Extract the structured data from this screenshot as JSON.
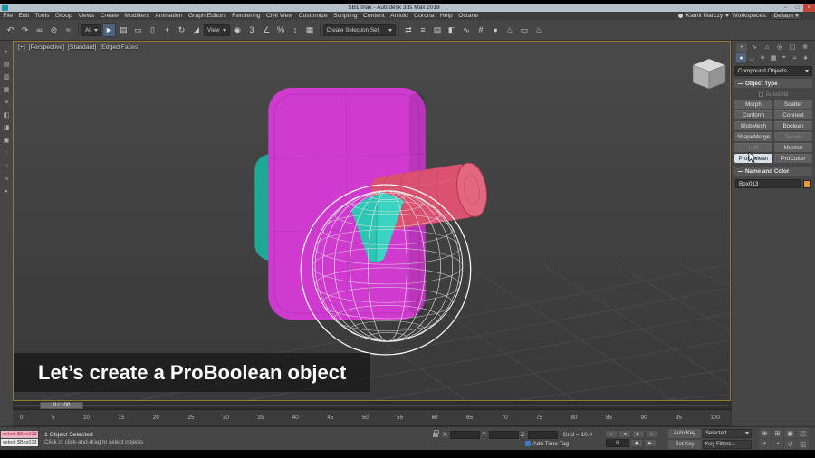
{
  "titlebar": {
    "title": "SB1.max - Autodesk 3ds Max 2018",
    "window_buttons": [
      {
        "name": "minimize-button",
        "glyph": "−"
      },
      {
        "name": "maximize-button",
        "glyph": "□"
      },
      {
        "name": "close-button",
        "glyph": "×"
      }
    ]
  },
  "menubar": {
    "items": [
      "File",
      "Edit",
      "Tools",
      "Group",
      "Views",
      "Create",
      "Modifiers",
      "Animation",
      "Graph Editors",
      "Rendering",
      "Civil View",
      "Customize",
      "Scripting",
      "Content",
      "Arnold",
      "Corona",
      "Help",
      "Octane"
    ],
    "user_name": "Kamil Marczy",
    "workspaces_label": "Workspaces:",
    "workspaces_value": "Default"
  },
  "toolbar": {
    "icons_a": [
      {
        "name": "undo-icon",
        "glyph": "↶"
      },
      {
        "name": "redo-icon",
        "glyph": "↷"
      },
      {
        "name": "select-link-icon",
        "glyph": "∞"
      },
      {
        "name": "unlink-icon",
        "glyph": "⊘"
      },
      {
        "name": "bind-spacewarp-icon",
        "glyph": "≈"
      }
    ],
    "selection_filter": "All",
    "icons_b": [
      {
        "name": "select-object-icon",
        "glyph": "►",
        "state": "active"
      },
      {
        "name": "select-by-name-icon",
        "glyph": "▤"
      },
      {
        "name": "rect-region-icon",
        "glyph": "▭"
      },
      {
        "name": "window-crossing-icon",
        "glyph": "▯"
      },
      {
        "name": "select-move-icon",
        "glyph": "+"
      },
      {
        "name": "select-rotate-icon",
        "glyph": "↻"
      },
      {
        "name": "select-scale-icon",
        "glyph": "◢"
      }
    ],
    "ref_coord": "View",
    "icons_c": [
      {
        "name": "use-center-icon",
        "glyph": "◉"
      },
      {
        "name": "snaps-toggle-icon",
        "glyph": "3"
      },
      {
        "name": "angle-snap-icon",
        "glyph": "∠"
      },
      {
        "name": "percent-snap-icon",
        "glyph": "%"
      },
      {
        "name": "spinner-snap-icon",
        "glyph": "↕"
      },
      {
        "name": "edit-named-selections-icon",
        "glyph": "▦"
      }
    ],
    "named_selection_placeholder": "Create Selection Set",
    "icons_d": [
      {
        "name": "mirror-icon",
        "glyph": "⇄"
      },
      {
        "name": "align-icon",
        "glyph": "≡"
      },
      {
        "name": "layer-manager-icon",
        "glyph": "▤"
      },
      {
        "name": "ribbon-icon",
        "glyph": "◧"
      },
      {
        "name": "curve-editor-icon",
        "glyph": "∿"
      },
      {
        "name": "schematic-view-icon",
        "glyph": "#"
      },
      {
        "name": "material-editor-icon",
        "glyph": "●"
      },
      {
        "name": "render-setup-icon",
        "glyph": "♨"
      },
      {
        "name": "rendered-frame-icon",
        "glyph": "▭"
      },
      {
        "name": "render-production-icon",
        "glyph": "♨"
      }
    ]
  },
  "left_toolbar": {
    "icons": [
      "▸",
      "▤",
      "▥",
      "▦",
      "≡",
      "◧",
      "◨",
      "▣",
      "◌",
      "⌂",
      "∿",
      "▸"
    ]
  },
  "viewport": {
    "labels": [
      "[+]",
      "[Perspective]",
      "[Standard]",
      "[Edged Faces]"
    ],
    "caption": "Let’s create a ProBoolean object",
    "colors": {
      "box": "#cf3bce",
      "box_edge": "#a126a1",
      "cylinder": "#da5270",
      "cylinder_cap": "#e3677f",
      "cylinder_edge": "#a93853",
      "teal": "#2dc6b4",
      "teal_light": "#3ed6c4",
      "teal_dark": "#21a795",
      "wire": "#e6e6e6",
      "selection_ring": "#f5f5f5",
      "grid_line": "#4d4d4d"
    }
  },
  "command_panel": {
    "tabs": [
      {
        "name": "create-tab-icon",
        "glyph": "+",
        "state": "active"
      },
      {
        "name": "modify-tab-icon",
        "glyph": "∿"
      },
      {
        "name": "hierarchy-tab-icon",
        "glyph": "⌂"
      },
      {
        "name": "motion-tab-icon",
        "glyph": "◎"
      },
      {
        "name": "display-tab-icon",
        "glyph": "▢"
      },
      {
        "name": "utilities-tab-icon",
        "glyph": "※"
      }
    ],
    "categories": [
      {
        "name": "geometry-category-icon",
        "glyph": "●",
        "state": "active"
      },
      {
        "name": "shapes-category-icon",
        "glyph": "◡"
      },
      {
        "name": "lights-category-icon",
        "glyph": "☀"
      },
      {
        "name": "cameras-category-icon",
        "glyph": "▦"
      },
      {
        "name": "helpers-category-icon",
        "glyph": "⌖"
      },
      {
        "name": "spacewarps-category-icon",
        "glyph": "≈"
      },
      {
        "name": "systems-category-icon",
        "glyph": "∗"
      }
    ],
    "category_dropdown": "Compound Objects",
    "object_type": {
      "title": "Object Type",
      "autogrid_label": "AutoGrid",
      "buttons": [
        {
          "label": "Morph"
        },
        {
          "label": "Scatter"
        },
        {
          "label": "Conform"
        },
        {
          "label": "Connect"
        },
        {
          "label": "BlobMesh"
        },
        {
          "label": "Boolean"
        },
        {
          "label": "ShapeMerge"
        },
        {
          "label": "Terrain",
          "state": "disabled"
        },
        {
          "label": "Loft",
          "state": "disabled"
        },
        {
          "label": "Mesher"
        },
        {
          "label": "ProBoolean",
          "state": "active"
        },
        {
          "label": "ProCutter"
        }
      ]
    },
    "name_color": {
      "title": "Name and Color",
      "object_name": "Box013",
      "swatch_color": "#e39b3b"
    }
  },
  "timeline": {
    "handle_label": "0 / 100",
    "ticks": [
      "0",
      "5",
      "10",
      "15",
      "20",
      "25",
      "30",
      "35",
      "40",
      "45",
      "50",
      "55",
      "60",
      "65",
      "70",
      "75",
      "80",
      "85",
      "90",
      "95",
      "100"
    ]
  },
  "status_bar": {
    "macro_line": "select $Box013",
    "listener_line": "select $Box013",
    "selection_status": "1 Object Selected",
    "prompt": "Click or click-and-drag to select objects",
    "coord_labels": [
      "X:",
      "Y:",
      "Z:"
    ],
    "coord_values": [
      "",
      "",
      ""
    ],
    "grid_label": "Grid = 10.0",
    "add_time_tag": "Add Time Tag",
    "transport": [
      {
        "name": "go-to-start-icon",
        "glyph": "«"
      },
      {
        "name": "previous-frame-icon",
        "glyph": "◄"
      },
      {
        "name": "play-icon",
        "glyph": "►"
      },
      {
        "name": "go-to-end-icon",
        "glyph": "»"
      }
    ],
    "frame_field": "0",
    "transport2": [
      {
        "name": "key-mode-toggle-icon",
        "glyph": "◆"
      },
      {
        "name": "next-key-icon",
        "glyph": "►"
      }
    ],
    "auto_key": "Auto Key",
    "selected_dropdown": "Selected",
    "set_key": "Set Key",
    "key_filters": "Key Filters...",
    "nav": [
      {
        "name": "zoom-icon",
        "glyph": "⊕"
      },
      {
        "name": "zoom-all-icon",
        "glyph": "⊞"
      },
      {
        "name": "zoom-extents-icon",
        "glyph": "▣"
      },
      {
        "name": "zoom-region-icon",
        "glyph": "◰"
      },
      {
        "name": "pan-icon",
        "glyph": "+"
      },
      {
        "name": "fov-icon",
        "glyph": "◔"
      },
      {
        "name": "orbit-icon",
        "glyph": "↺"
      },
      {
        "name": "maximize-viewport-icon",
        "glyph": "◱"
      }
    ]
  }
}
